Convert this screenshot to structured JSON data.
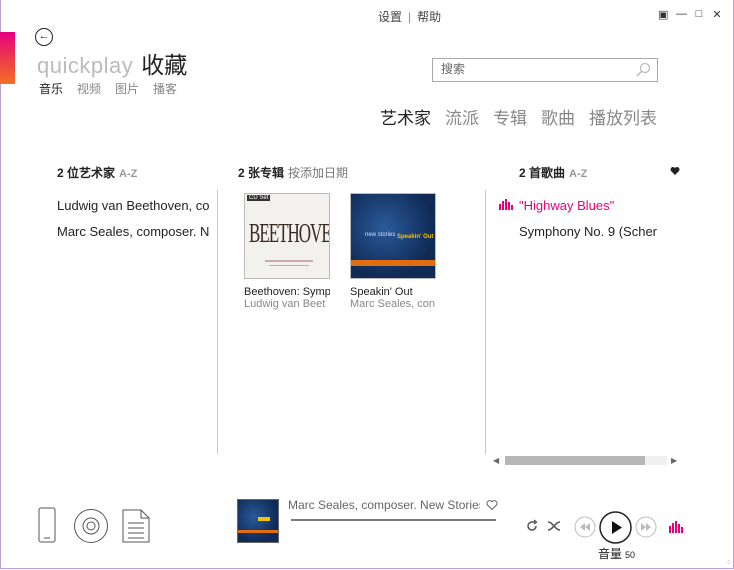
{
  "top_menu": {
    "settings": "设置",
    "help": "帮助"
  },
  "window_controls": {
    "minimode": "▣",
    "minimize": "—",
    "maximize": "□",
    "close": "✕"
  },
  "header": {
    "app_name": "quickplay",
    "page_title": "收藏"
  },
  "subnav": [
    "音乐",
    "视频",
    "图片",
    "播客"
  ],
  "search": {
    "placeholder": "搜索"
  },
  "view_tabs": [
    "艺术家",
    "流派",
    "专辑",
    "歌曲",
    "播放列表"
  ],
  "artists": {
    "count_label": "2 位艺术家",
    "sort": "A-Z",
    "items": [
      "Ludwig van Beethoven, co",
      "Marc Seales, composer. N"
    ]
  },
  "albums": {
    "count_label": "2 张专辑",
    "sort": "按添加日期",
    "items": [
      {
        "title": "Beethoven: Symp",
        "artist": "Ludwig van Beet",
        "cover_text": "BEETHOVEN",
        "cover_badge": "CD Set"
      },
      {
        "title": "Speakin' Out",
        "artist": "Marc Seales, con",
        "cover_text": "new stories",
        "cover_badge": "Speakin' Out"
      }
    ]
  },
  "songs": {
    "count_label": "2 首歌曲",
    "sort": "A-Z",
    "items": [
      "\"Highway Blues\"",
      "Symphony No. 9 (Scher"
    ]
  },
  "now_playing": {
    "title": "Marc Seales, composer. New Stories"
  },
  "volume": {
    "label": "音量",
    "value": "50"
  },
  "colors": {
    "accent": "#e6007e",
    "accent2": "#f37021"
  }
}
